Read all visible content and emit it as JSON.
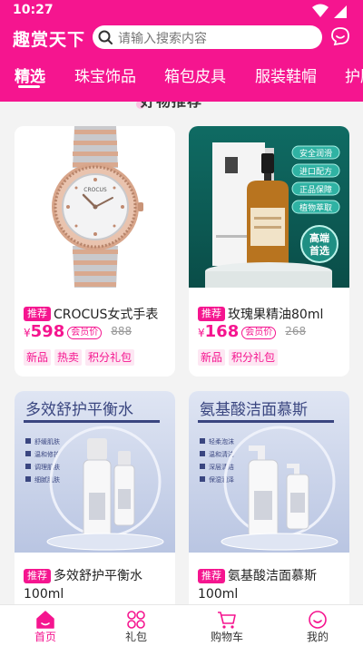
{
  "status": {
    "time": "10:27"
  },
  "header": {
    "app_title": "趣赏天下",
    "search_placeholder": "请输入搜索内容"
  },
  "tabs": [
    "精选",
    "珠宝饰品",
    "箱包皮具",
    "服装鞋帽",
    "护肤"
  ],
  "active_tab": "精选",
  "section_heading": "好物推荐",
  "products": [
    {
      "tag": "推荐",
      "title": "CROCUS女式手表",
      "price_symbol": "¥",
      "price": "598",
      "member_label": "会员价",
      "original_price": "888",
      "labels": [
        "新品",
        "热卖",
        "积分礼包"
      ],
      "image_brand": "CROCUS"
    },
    {
      "tag": "推荐",
      "title": "玫瑰果精油80ml",
      "price_symbol": "¥",
      "price": "168",
      "member_label": "会员价",
      "original_price": "268",
      "labels": [
        "新品",
        "积分礼包"
      ],
      "image_badges": [
        "安全润滑",
        "进口配方",
        "正品保障",
        "植物萃取"
      ],
      "image_corner": [
        "高端",
        "首选"
      ]
    },
    {
      "tag": "推荐",
      "title": "多效舒护平衡水100ml",
      "image_heading": "多效舒护平衡水",
      "image_features": [
        "舒缓肌肤",
        "温和修护",
        "调理肌肤",
        "细腻肌肤"
      ]
    },
    {
      "tag": "推荐",
      "title": "氨基酸洁面慕斯100ml",
      "image_heading": "氨基酸洁面慕斯",
      "image_features": [
        "轻柔泡沫",
        "温和清洁",
        "深层清洁",
        "保湿润泽"
      ]
    }
  ],
  "bottom_nav": [
    {
      "label": "首页",
      "icon": "home-icon",
      "active": true
    },
    {
      "label": "礼包",
      "icon": "gift-pack-icon",
      "active": false
    },
    {
      "label": "购物车",
      "icon": "cart-icon",
      "active": false
    },
    {
      "label": "我的",
      "icon": "profile-icon",
      "active": false
    }
  ],
  "colors": {
    "brand": "#f5158f",
    "background": "#f3f3f3"
  }
}
